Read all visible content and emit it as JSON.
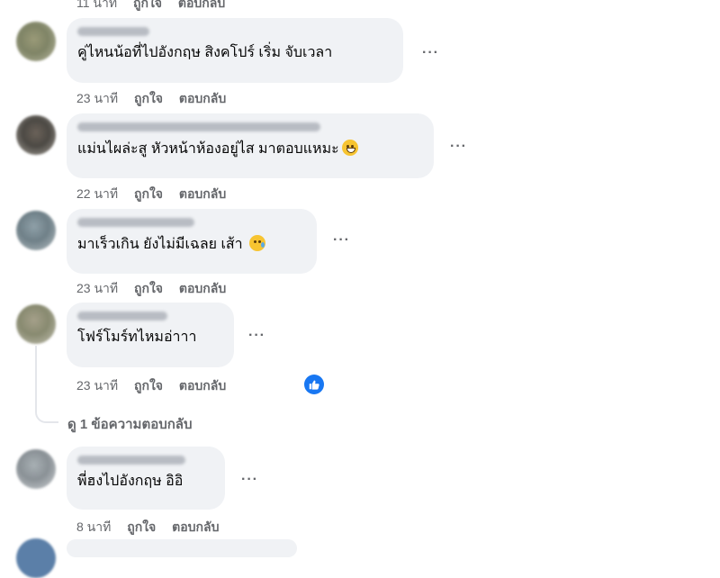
{
  "top_meta": {
    "time": "11 นาที",
    "like": "ถูกใจ",
    "reply": "ตอบกลับ"
  },
  "comments": [
    {
      "text": "คู่ไหนน้อที่ไปอังกฤษ สิงคโปร์ เริ่ม จับเวลา",
      "time": "23 นาที",
      "like": "ถูกใจ",
      "reply": "ตอบกลับ"
    },
    {
      "text": "แม่นไผล่ะสู หัวหน้าห้องอยู่ไส มาตอบแหมะ",
      "time": "22 นาที",
      "like": "ถูกใจ",
      "reply": "ตอบกลับ"
    },
    {
      "text": "มาเร็วเกิน ยังไม่มีเฉลย เส้า",
      "time": "23 นาที",
      "like": "ถูกใจ",
      "reply": "ตอบกลับ"
    },
    {
      "text": "โฟร์โมร์ทไหมอ่าาา",
      "time": "23 นาที",
      "like": "ถูกใจ",
      "reply": "ตอบกลับ"
    },
    {
      "text": "พี่ฮงไปอังกฤษ อิอิ",
      "time": "8 นาที",
      "like": "ถูกใจ",
      "reply": "ตอบกลับ"
    }
  ],
  "more_label": "···",
  "view_replies": "ดู 1 ข้อความตอบกลับ",
  "colors": {
    "bubble": "#f0f2f5",
    "meta": "#65676b",
    "like_blue": "#1877f2"
  }
}
